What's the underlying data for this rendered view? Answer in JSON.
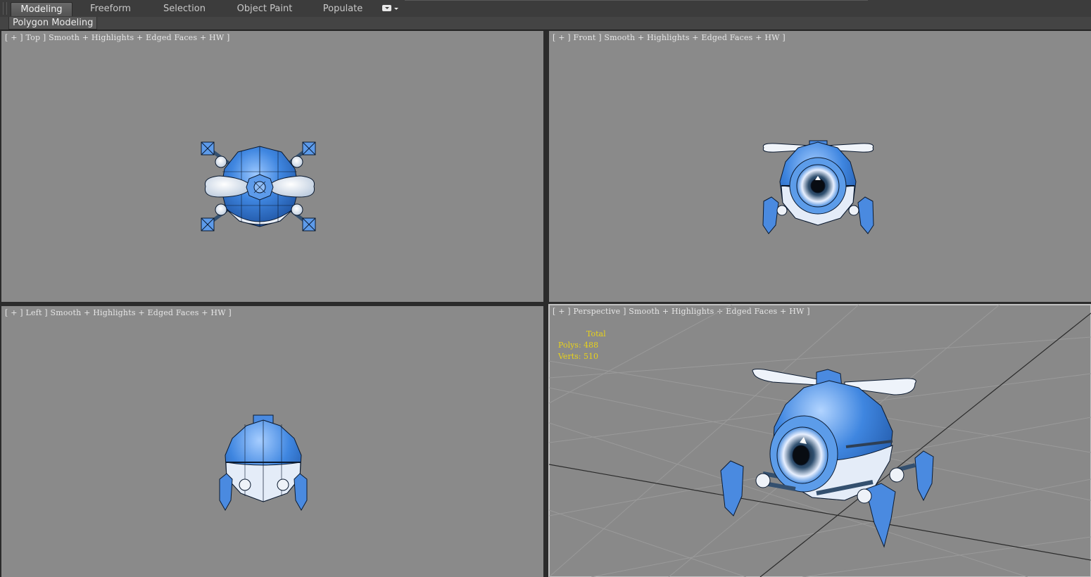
{
  "ribbon": {
    "tabs": [
      {
        "label": "Modeling",
        "active": true
      },
      {
        "label": "Freeform",
        "active": false
      },
      {
        "label": "Selection",
        "active": false
      },
      {
        "label": "Object Paint",
        "active": false
      },
      {
        "label": "Populate",
        "active": false
      }
    ],
    "menu_icon": "dropdown-options-icon"
  },
  "panel": {
    "label": "Polygon Modeling"
  },
  "viewports": {
    "top": {
      "label": "[ + ] Top ] Smooth + Highlights + Edged Faces + HW ]"
    },
    "front": {
      "label": "[ + ] Front ] Smooth + Highlights + Edged Faces + HW ]"
    },
    "left": {
      "label": "[ + ] Left ] Smooth + Highlights + Edged Faces + HW ]"
    },
    "perspective": {
      "label": "[ + ] Perspective ] Smooth + Highlights + Edged Faces + HW ]"
    }
  },
  "statistics": {
    "title": "Total",
    "polys": "Polys: 488",
    "verts": "Verts: 510"
  },
  "colors": {
    "viewport_bg": "#8a8a8a",
    "model_blue": "#3f86e0",
    "stats_text": "#e8d21a",
    "active_viewport_border": "#c3c3c3"
  }
}
